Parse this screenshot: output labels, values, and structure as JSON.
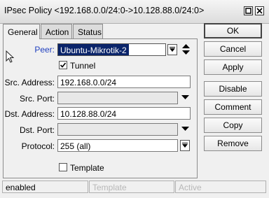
{
  "window": {
    "title": "IPsec Policy <192.168.0.0/24:0->10.128.88.0/24:0>"
  },
  "tabs": [
    {
      "label": "General"
    },
    {
      "label": "Action"
    },
    {
      "label": "Status"
    }
  ],
  "form": {
    "peer": {
      "label": "Peer:",
      "value": "Ubuntu-Mikrotik-2"
    },
    "tunnel": {
      "label": "Tunnel",
      "checked": true
    },
    "src_address": {
      "label": "Src. Address:",
      "value": "192.168.0.0/24"
    },
    "src_port": {
      "label": "Src. Port:",
      "value": ""
    },
    "dst_address": {
      "label": "Dst. Address:",
      "value": "10.128.88.0/24"
    },
    "dst_port": {
      "label": "Dst. Port:",
      "value": ""
    },
    "protocol": {
      "label": "Protocol:",
      "value": "255 (all)"
    },
    "template": {
      "label": "Template",
      "checked": false
    }
  },
  "buttons": {
    "ok": "OK",
    "cancel": "Cancel",
    "apply": "Apply",
    "disable": "Disable",
    "comment": "Comment",
    "copy": "Copy",
    "remove": "Remove"
  },
  "statusbar": {
    "state": "enabled",
    "template": "Template",
    "active": "Active"
  },
  "colors": {
    "peer_label": "#1f3fbf",
    "selection": "#0a246a"
  }
}
